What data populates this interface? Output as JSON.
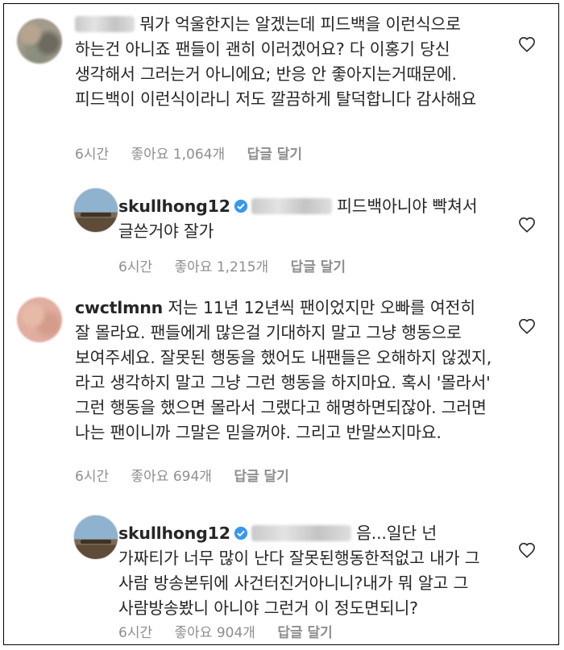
{
  "comments": [
    {
      "username": "",
      "text": "뭐가 억울한지는 알겠는데 피드백을 이런식으로 하는건 아니죠 팬들이 괜히 이러겠어요? 다 이홍기 당신 생각해서 그러는거 아니에요; 반응 안 좋아지는거때문에. 피드백이 이런식이라니 저도 깔끔하게 탈덕합니다 감사해요",
      "time": "6시간",
      "likes": "좋아요 1,064개",
      "reply": "답글 달기"
    },
    {
      "username": "skullhong12",
      "text": "피드백아니야 빡쳐서 글쓴거야  잘가",
      "time": "6시간",
      "likes": "좋아요 1,215개",
      "reply": "답글 달기"
    },
    {
      "username": "cwctlmnn",
      "text": "저는 11년 12년씩 팬이었지만 오빠를 여전히 잘 몰라요. 팬들에게 많은걸 기대하지 말고 그냥 행동으로 보여주세요. 잘못된 행동을 했어도 내팬들은 오해하지 않겠지, 라고 생각하지 말고 그냥 그런 행동을 하지마요. 혹시 '몰라서' 그런 행동을 했으면 몰라서 그랬다고 해명하면되잖아. 그러면 나는 팬이니까 그말은 믿을꺼야. 그리고 반말쓰지마요.",
      "time": "6시간",
      "likes": "좋아요 694개",
      "reply": "답글 달기"
    },
    {
      "username": "skullhong12",
      "text": "음...일단 넌 가짜티가 너무 많이 난다 잘못된행동한적없고 내가 그 사람 방송본뒤에 사건터진거아니니?내가 뭐 알고 그 사람방송봤니 아니야 그런거 이 정도면되니?",
      "time": "6시간",
      "likes": "좋아요 904개",
      "reply": "답글 달기"
    }
  ],
  "icons": {
    "heart": "heart-outline-icon",
    "verified": "verified-badge-icon"
  },
  "colors": {
    "verified": "#3897f0",
    "meta": "#8e8e8e",
    "text": "#262626"
  }
}
